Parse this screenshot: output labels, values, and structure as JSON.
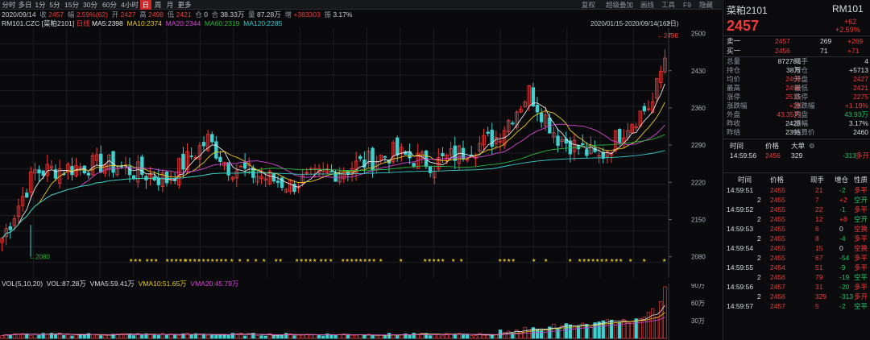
{
  "toolbar": {
    "periods": [
      "分时",
      "多日",
      "1分",
      "5分",
      "15分",
      "30分",
      "60分",
      "4小时",
      "日",
      "周",
      "月",
      "更多"
    ],
    "active": "日",
    "right": [
      "复权",
      "超级叠加",
      "画线",
      "工具",
      "F9",
      "隐藏"
    ]
  },
  "info": {
    "date": "2020/09/14",
    "close_label": "收",
    "close": "2457",
    "change_label": "幅",
    "change": "2.59%(62)",
    "open_label": "开",
    "open": "2427",
    "high_label": "高",
    "high": "2498",
    "low_label": "低",
    "low": "2421",
    "pos_label": "仓",
    "pos": "0",
    "amount_label": "合",
    "amount": "38.33万",
    "vol_label": "量",
    "vol": "87.28万",
    "incr_label": "增",
    "incr": "+383303",
    "amp_label": "振",
    "amp": "3.17%"
  },
  "ma": {
    "code": "RM101.CZC [菜粕2101]",
    "daily": "日线",
    "ma5": "MA5:2398",
    "ma10": "MA10:2374",
    "ma20": "MA20:2344",
    "ma60": "MA60:2319",
    "ma120": "MA120:2285"
  },
  "range": "2020/01/15-2020/09/14(162日)",
  "vol": {
    "label": "VOL(5,10,20)",
    "vol": "VOL:87.28万",
    "v5": "VMA5:59.41万",
    "v10": "VMA10:51.65万",
    "v20": "VMA20:45.79万",
    "axis": [
      "90万",
      "60万",
      "30万"
    ]
  },
  "colors": {
    "up": "#ef3a3a",
    "down": "#3fd0d0",
    "ma5": "#e8e8e8",
    "ma10": "#e8c81c",
    "ma20": "#d247d2",
    "ma60": "#2bb53c",
    "ma120": "#38c9c9",
    "star": "#e8c81c"
  },
  "chart_data": {
    "type": "candlestick",
    "ylim": [
      2040,
      2510
    ],
    "yticks": [
      2500,
      2430,
      2360,
      2290,
      2220,
      2150,
      2080
    ],
    "high_label": "2498",
    "low_label": "2080",
    "stars": "★",
    "candles": [
      [
        2112,
        2122,
        2102,
        2105
      ],
      [
        2100,
        2108,
        2095,
        2104
      ]
    ]
  },
  "right_panel": {
    "name": "菜粕2101",
    "code": "RM101",
    "price": "2457",
    "chg": "+62",
    "pct": "+2.59%",
    "ob": [
      {
        "k": "卖一",
        "p": "2457",
        "v": "269",
        "d": "+269"
      },
      {
        "k": "买一",
        "p": "2456",
        "v": "71",
        "d": "+71"
      }
    ],
    "stats": [
      [
        "总量",
        "872786",
        "现手",
        "4"
      ],
      [
        "持仓",
        "38万",
        "增仓",
        "+5713"
      ],
      [
        "均价",
        "2460",
        "开盘",
        "2427"
      ],
      [
        "最高",
        "2498",
        "最低",
        "2421"
      ],
      [
        "涨停",
        "2515",
        "跌停",
        "2275"
      ],
      [
        "涨跌幅close",
        "+29",
        "涨跌幅close",
        "+1.19%"
      ],
      [
        "外盘",
        "43.35万",
        "内盘",
        "43.93万"
      ],
      [
        "昨收",
        "2428",
        "振幅",
        "3.17%"
      ],
      [
        "昨结",
        "2395",
        "结算价",
        "2460"
      ]
    ],
    "hdr1": [
      "时间",
      "价格",
      "大单",
      "",
      ""
    ],
    "big": [
      [
        "14:59:56",
        "2456",
        "329",
        "-313",
        "多开"
      ]
    ],
    "hdr2": [
      "时间",
      "价格",
      "现手",
      "增仓",
      "性质"
    ],
    "ticks": [
      [
        "14:59:51",
        "2455",
        "21",
        "-2",
        "多平"
      ],
      [
        "2",
        "2455",
        "7",
        "+2",
        "空开"
      ],
      [
        "14:59:52",
        "2455",
        "22",
        "-1",
        "多平"
      ],
      [
        "2",
        "2455",
        "12",
        "+8",
        "空开"
      ],
      [
        "14:59:53",
        "2455",
        "6",
        "0",
        "空换"
      ],
      [
        "2",
        "2455",
        "8",
        "-4",
        "多平"
      ],
      [
        "14:59:54",
        "2455",
        "15",
        "0",
        "空换"
      ],
      [
        "2",
        "2455",
        "67",
        "-54",
        "多平"
      ],
      [
        "14:59:55",
        "2454",
        "51",
        "-9",
        "多平"
      ],
      [
        "2",
        "2456",
        "79",
        "-19",
        "空平"
      ],
      [
        "14:59:56",
        "2457",
        "31",
        "-20",
        "多平"
      ],
      [
        "2",
        "2456",
        "329",
        "-313",
        "多开"
      ],
      [
        "14:59:57",
        "2457",
        "5",
        "-2",
        "空平"
      ]
    ]
  }
}
